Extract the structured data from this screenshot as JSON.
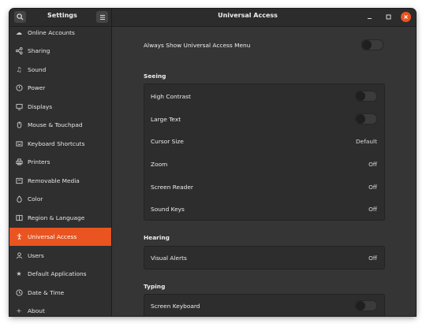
{
  "window": {
    "sidebar_title": "Settings",
    "panel_title": "Universal Access"
  },
  "sidebar": {
    "items": [
      {
        "label": "Online Accounts",
        "icon": "cloud-icon"
      },
      {
        "label": "Sharing",
        "icon": "share-icon"
      },
      {
        "label": "Sound",
        "icon": "music-note-icon"
      },
      {
        "label": "Power",
        "icon": "power-icon"
      },
      {
        "label": "Displays",
        "icon": "display-icon"
      },
      {
        "label": "Mouse & Touchpad",
        "icon": "mouse-icon"
      },
      {
        "label": "Keyboard Shortcuts",
        "icon": "keyboard-icon"
      },
      {
        "label": "Printers",
        "icon": "printer-icon"
      },
      {
        "label": "Removable Media",
        "icon": "media-icon"
      },
      {
        "label": "Color",
        "icon": "color-icon"
      },
      {
        "label": "Region & Language",
        "icon": "region-icon"
      },
      {
        "label": "Universal Access",
        "icon": "accessibility-icon",
        "active": true
      },
      {
        "label": "Users",
        "icon": "user-icon"
      },
      {
        "label": "Default Applications",
        "icon": "star-icon"
      },
      {
        "label": "Date & Time",
        "icon": "clock-icon"
      },
      {
        "label": "About",
        "icon": "plus-icon"
      }
    ]
  },
  "main": {
    "always_show_label": "Always Show Universal Access Menu",
    "always_show_on": false,
    "seeing": {
      "heading": "Seeing",
      "high_contrast": "High Contrast",
      "high_contrast_on": false,
      "large_text": "Large Text",
      "large_text_on": false,
      "cursor_size": "Cursor Size",
      "cursor_size_value": "Default",
      "zoom": "Zoom",
      "zoom_value": "Off",
      "screen_reader": "Screen Reader",
      "screen_reader_value": "Off",
      "sound_keys": "Sound Keys",
      "sound_keys_value": "Off"
    },
    "hearing": {
      "heading": "Hearing",
      "visual_alerts": "Visual Alerts",
      "visual_alerts_value": "Off"
    },
    "typing": {
      "heading": "Typing",
      "screen_keyboard": "Screen Keyboard",
      "screen_keyboard_on": false
    }
  },
  "colors": {
    "accent": "#e95420",
    "window_bg": "#353535",
    "sidebar_bg": "#2f2f2f",
    "titlebar_bg": "#2c2c2c"
  }
}
